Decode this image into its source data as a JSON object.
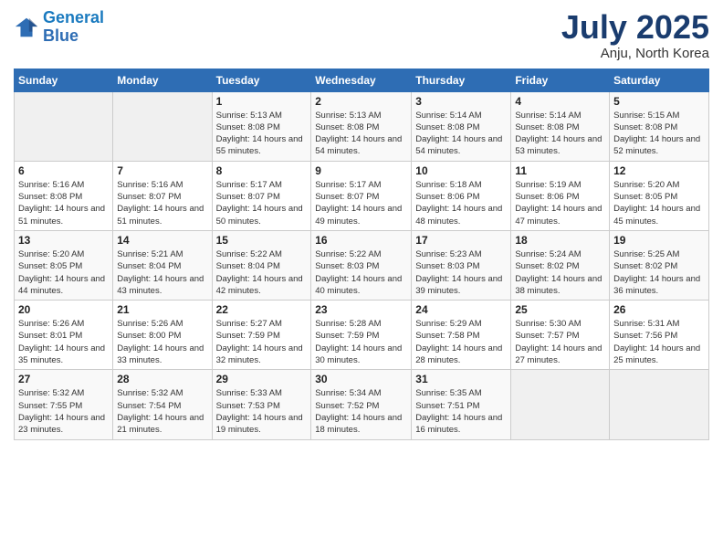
{
  "logo": {
    "line1": "General",
    "line2": "Blue"
  },
  "title": "July 2025",
  "location": "Anju, North Korea",
  "days_header": [
    "Sunday",
    "Monday",
    "Tuesday",
    "Wednesday",
    "Thursday",
    "Friday",
    "Saturday"
  ],
  "weeks": [
    [
      {
        "num": "",
        "sunrise": "",
        "sunset": "",
        "daylight": ""
      },
      {
        "num": "",
        "sunrise": "",
        "sunset": "",
        "daylight": ""
      },
      {
        "num": "1",
        "sunrise": "Sunrise: 5:13 AM",
        "sunset": "Sunset: 8:08 PM",
        "daylight": "Daylight: 14 hours and 55 minutes."
      },
      {
        "num": "2",
        "sunrise": "Sunrise: 5:13 AM",
        "sunset": "Sunset: 8:08 PM",
        "daylight": "Daylight: 14 hours and 54 minutes."
      },
      {
        "num": "3",
        "sunrise": "Sunrise: 5:14 AM",
        "sunset": "Sunset: 8:08 PM",
        "daylight": "Daylight: 14 hours and 54 minutes."
      },
      {
        "num": "4",
        "sunrise": "Sunrise: 5:14 AM",
        "sunset": "Sunset: 8:08 PM",
        "daylight": "Daylight: 14 hours and 53 minutes."
      },
      {
        "num": "5",
        "sunrise": "Sunrise: 5:15 AM",
        "sunset": "Sunset: 8:08 PM",
        "daylight": "Daylight: 14 hours and 52 minutes."
      }
    ],
    [
      {
        "num": "6",
        "sunrise": "Sunrise: 5:16 AM",
        "sunset": "Sunset: 8:08 PM",
        "daylight": "Daylight: 14 hours and 51 minutes."
      },
      {
        "num": "7",
        "sunrise": "Sunrise: 5:16 AM",
        "sunset": "Sunset: 8:07 PM",
        "daylight": "Daylight: 14 hours and 51 minutes."
      },
      {
        "num": "8",
        "sunrise": "Sunrise: 5:17 AM",
        "sunset": "Sunset: 8:07 PM",
        "daylight": "Daylight: 14 hours and 50 minutes."
      },
      {
        "num": "9",
        "sunrise": "Sunrise: 5:17 AM",
        "sunset": "Sunset: 8:07 PM",
        "daylight": "Daylight: 14 hours and 49 minutes."
      },
      {
        "num": "10",
        "sunrise": "Sunrise: 5:18 AM",
        "sunset": "Sunset: 8:06 PM",
        "daylight": "Daylight: 14 hours and 48 minutes."
      },
      {
        "num": "11",
        "sunrise": "Sunrise: 5:19 AM",
        "sunset": "Sunset: 8:06 PM",
        "daylight": "Daylight: 14 hours and 47 minutes."
      },
      {
        "num": "12",
        "sunrise": "Sunrise: 5:20 AM",
        "sunset": "Sunset: 8:05 PM",
        "daylight": "Daylight: 14 hours and 45 minutes."
      }
    ],
    [
      {
        "num": "13",
        "sunrise": "Sunrise: 5:20 AM",
        "sunset": "Sunset: 8:05 PM",
        "daylight": "Daylight: 14 hours and 44 minutes."
      },
      {
        "num": "14",
        "sunrise": "Sunrise: 5:21 AM",
        "sunset": "Sunset: 8:04 PM",
        "daylight": "Daylight: 14 hours and 43 minutes."
      },
      {
        "num": "15",
        "sunrise": "Sunrise: 5:22 AM",
        "sunset": "Sunset: 8:04 PM",
        "daylight": "Daylight: 14 hours and 42 minutes."
      },
      {
        "num": "16",
        "sunrise": "Sunrise: 5:22 AM",
        "sunset": "Sunset: 8:03 PM",
        "daylight": "Daylight: 14 hours and 40 minutes."
      },
      {
        "num": "17",
        "sunrise": "Sunrise: 5:23 AM",
        "sunset": "Sunset: 8:03 PM",
        "daylight": "Daylight: 14 hours and 39 minutes."
      },
      {
        "num": "18",
        "sunrise": "Sunrise: 5:24 AM",
        "sunset": "Sunset: 8:02 PM",
        "daylight": "Daylight: 14 hours and 38 minutes."
      },
      {
        "num": "19",
        "sunrise": "Sunrise: 5:25 AM",
        "sunset": "Sunset: 8:02 PM",
        "daylight": "Daylight: 14 hours and 36 minutes."
      }
    ],
    [
      {
        "num": "20",
        "sunrise": "Sunrise: 5:26 AM",
        "sunset": "Sunset: 8:01 PM",
        "daylight": "Daylight: 14 hours and 35 minutes."
      },
      {
        "num": "21",
        "sunrise": "Sunrise: 5:26 AM",
        "sunset": "Sunset: 8:00 PM",
        "daylight": "Daylight: 14 hours and 33 minutes."
      },
      {
        "num": "22",
        "sunrise": "Sunrise: 5:27 AM",
        "sunset": "Sunset: 7:59 PM",
        "daylight": "Daylight: 14 hours and 32 minutes."
      },
      {
        "num": "23",
        "sunrise": "Sunrise: 5:28 AM",
        "sunset": "Sunset: 7:59 PM",
        "daylight": "Daylight: 14 hours and 30 minutes."
      },
      {
        "num": "24",
        "sunrise": "Sunrise: 5:29 AM",
        "sunset": "Sunset: 7:58 PM",
        "daylight": "Daylight: 14 hours and 28 minutes."
      },
      {
        "num": "25",
        "sunrise": "Sunrise: 5:30 AM",
        "sunset": "Sunset: 7:57 PM",
        "daylight": "Daylight: 14 hours and 27 minutes."
      },
      {
        "num": "26",
        "sunrise": "Sunrise: 5:31 AM",
        "sunset": "Sunset: 7:56 PM",
        "daylight": "Daylight: 14 hours and 25 minutes."
      }
    ],
    [
      {
        "num": "27",
        "sunrise": "Sunrise: 5:32 AM",
        "sunset": "Sunset: 7:55 PM",
        "daylight": "Daylight: 14 hours and 23 minutes."
      },
      {
        "num": "28",
        "sunrise": "Sunrise: 5:32 AM",
        "sunset": "Sunset: 7:54 PM",
        "daylight": "Daylight: 14 hours and 21 minutes."
      },
      {
        "num": "29",
        "sunrise": "Sunrise: 5:33 AM",
        "sunset": "Sunset: 7:53 PM",
        "daylight": "Daylight: 14 hours and 19 minutes."
      },
      {
        "num": "30",
        "sunrise": "Sunrise: 5:34 AM",
        "sunset": "Sunset: 7:52 PM",
        "daylight": "Daylight: 14 hours and 18 minutes."
      },
      {
        "num": "31",
        "sunrise": "Sunrise: 5:35 AM",
        "sunset": "Sunset: 7:51 PM",
        "daylight": "Daylight: 14 hours and 16 minutes."
      },
      {
        "num": "",
        "sunrise": "",
        "sunset": "",
        "daylight": ""
      },
      {
        "num": "",
        "sunrise": "",
        "sunset": "",
        "daylight": ""
      }
    ]
  ]
}
